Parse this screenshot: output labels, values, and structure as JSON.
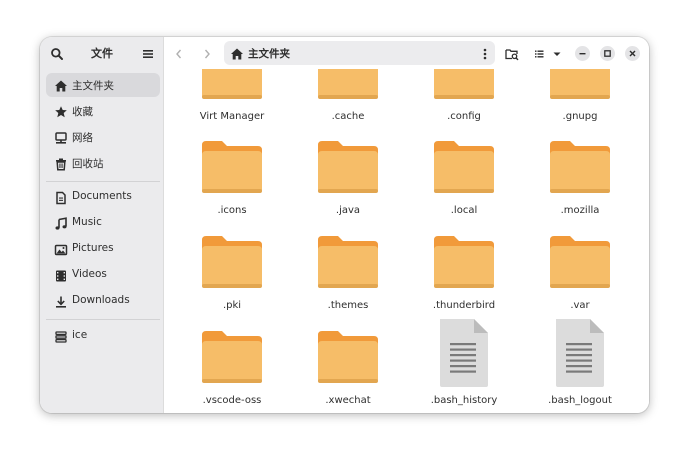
{
  "sidebar": {
    "title": "文件",
    "items": [
      {
        "label": "主文件夹",
        "icon": "home-icon",
        "active": true
      },
      {
        "label": "收藏",
        "icon": "star-icon",
        "active": false
      },
      {
        "label": "网络",
        "icon": "network-icon",
        "active": false
      },
      {
        "label": "回收站",
        "icon": "trash-icon",
        "active": false
      },
      {
        "label": "Documents",
        "icon": "document-icon",
        "active": false
      },
      {
        "label": "Music",
        "icon": "music-icon",
        "active": false
      },
      {
        "label": "Pictures",
        "icon": "picture-icon",
        "active": false
      },
      {
        "label": "Videos",
        "icon": "video-icon",
        "active": false
      },
      {
        "label": "Downloads",
        "icon": "download-icon",
        "active": false
      },
      {
        "label": "ice",
        "icon": "drive-icon",
        "active": false
      }
    ]
  },
  "header": {
    "path_label": "主文件夹"
  },
  "files": [
    {
      "name": "Virt Manager",
      "type": "folder"
    },
    {
      "name": ".cache",
      "type": "folder"
    },
    {
      "name": ".config",
      "type": "folder"
    },
    {
      "name": ".gnupg",
      "type": "folder"
    },
    {
      "name": ".icons",
      "type": "folder"
    },
    {
      "name": ".java",
      "type": "folder"
    },
    {
      "name": ".local",
      "type": "folder"
    },
    {
      "name": ".mozilla",
      "type": "folder"
    },
    {
      "name": ".pki",
      "type": "folder"
    },
    {
      "name": ".themes",
      "type": "folder"
    },
    {
      "name": ".thunderbird",
      "type": "folder"
    },
    {
      "name": ".var",
      "type": "folder"
    },
    {
      "name": ".vscode-oss",
      "type": "folder"
    },
    {
      "name": ".xwechat",
      "type": "folder"
    },
    {
      "name": ".bash_history",
      "type": "file"
    },
    {
      "name": ".bash_logout",
      "type": "file"
    }
  ],
  "colors": {
    "folder_body": "#f6bd68",
    "folder_tab": "#f19a3a",
    "file_page": "#dcdcdc"
  }
}
